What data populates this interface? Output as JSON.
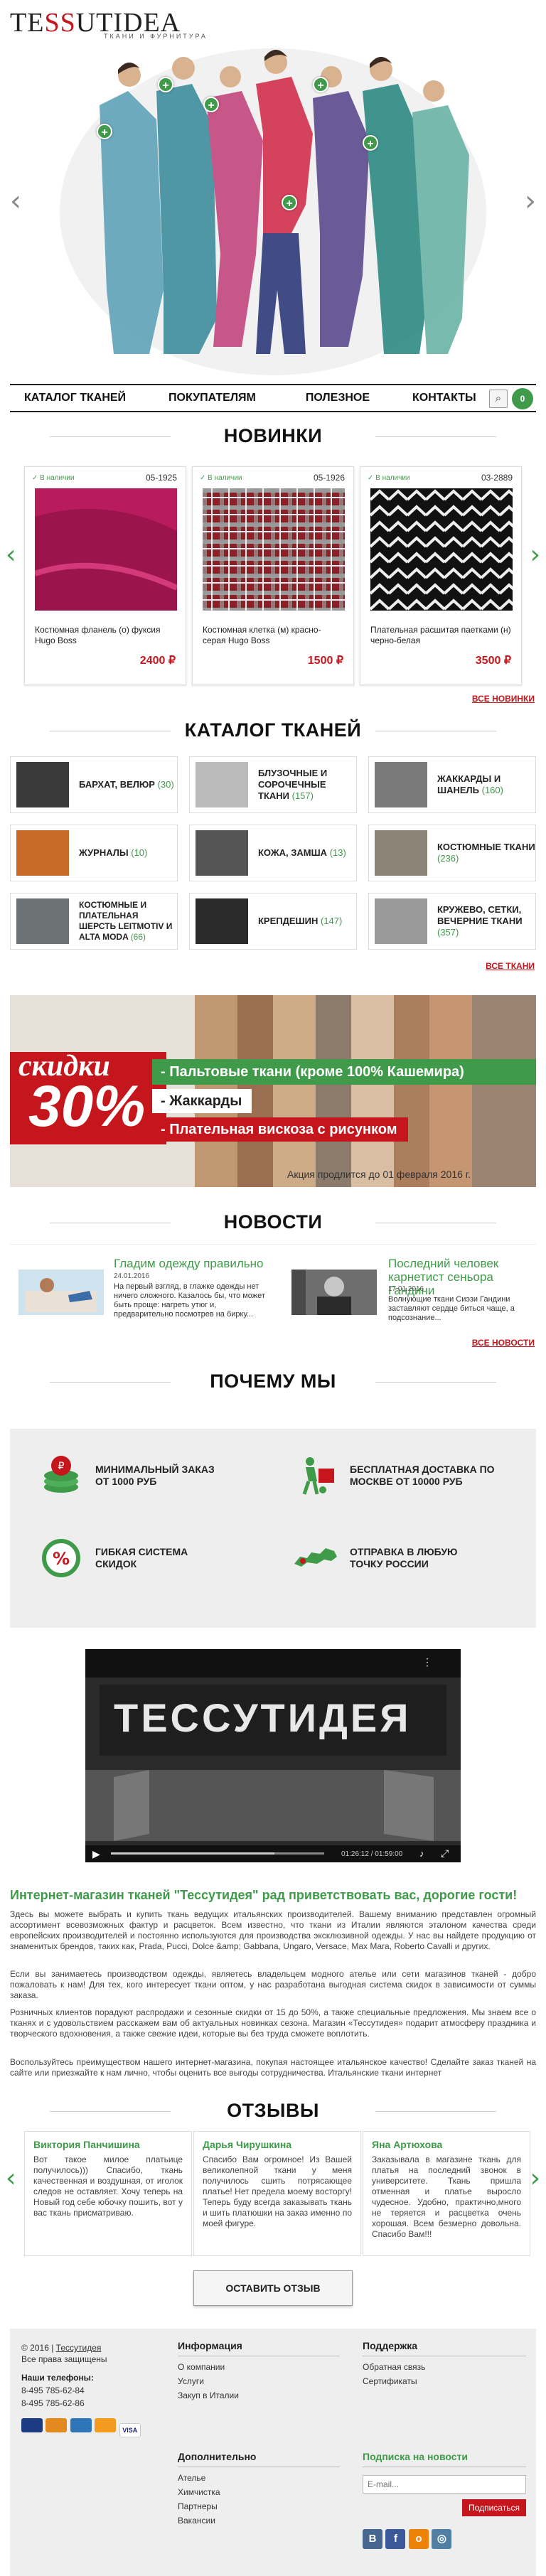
{
  "header": {
    "logo_main_left": "TE",
    "logo_main_accent": "SS",
    "logo_main_right": "UTIDEA",
    "logo_sub": "ТКАНИ И ФУРНИТУРА"
  },
  "nav": {
    "items": [
      "КАТАЛОГ ТКАНЕЙ",
      "ПОКУПАТЕЛЯМ",
      "ПОЛЕЗНОЕ",
      "КОНТАКТЫ"
    ],
    "search_icon": "search-icon",
    "cart_count": "0"
  },
  "new_arrivals": {
    "title": "НОВИНКИ",
    "more": "ВСЕ НОВИНКИ",
    "products": [
      {
        "stock": "В наличии",
        "code": "05-1925",
        "name": "Костюмная фланель (о) фуксия Hugo Boss",
        "price": "2400 ₽",
        "color": "#c02a6e"
      },
      {
        "stock": "В наличии",
        "code": "05-1926",
        "name": "Костюмная клетка (м) красно-серая Hugo Boss",
        "price": "1500 ₽",
        "color": "#9c2a2e"
      },
      {
        "stock": "В наличии",
        "code": "03-2889",
        "name": "Плательная расшитая паетками (н) черно-белая",
        "price": "3500 ₽",
        "color": "#222222"
      }
    ]
  },
  "catalog": {
    "title": "КАТАЛОГ ТКАНЕЙ",
    "more": "ВСЕ ТКАНИ",
    "items": [
      {
        "label": "БАРХАТ, ВЕЛЮР",
        "count": "(30)",
        "color": "#3a3a3a"
      },
      {
        "label": "БЛУЗОЧНЫЕ И СОРОЧЕЧНЫЕ ТКАНИ",
        "count": "(157)",
        "color": "#bbbbbb"
      },
      {
        "label": "ЖАККАРДЫ И ШАНЕЛЬ",
        "count": "(160)",
        "color": "#7a7a7a"
      },
      {
        "label": "ЖУРНАЛЫ",
        "count": "(10)",
        "color": "#c86a2a"
      },
      {
        "label": "КОЖА, ЗАМША",
        "count": "(13)",
        "color": "#555555"
      },
      {
        "label": "КОСТЮМНЫЕ ТКАНИ",
        "count": "(236)",
        "color": "#8d8478"
      },
      {
        "label": "КОСТЮМНЫЕ И ПЛАТЕЛЬНАЯ ШЕРСТЬ LEITMOTIV И ALTA MODA",
        "count": "(66)",
        "color": "#6d7274"
      },
      {
        "label": "КРЕПДЕШИН",
        "count": "(147)",
        "color": "#2a2a2a"
      },
      {
        "label": "КРУЖЕВО, СЕТКИ, ВЕЧЕРНИЕ ТКАНИ",
        "count": "(357)",
        "color": "#9a9a9a"
      }
    ]
  },
  "banner": {
    "discount_word": "скидки",
    "discount_value": "30%",
    "lines": [
      "- Пальтовые ткани (кроме 100% Кашемира)",
      "- Жаккарды",
      "- Плательная вискоза с рисунком"
    ],
    "footnote": "Акция продлится до 01 февраля 2016 г."
  },
  "news": {
    "title": "НОВОСТИ",
    "more": "ВСЕ НОВОСТИ",
    "items": [
      {
        "title": "Гладим одежду правильно",
        "date": "24.01.2016",
        "text": "На первый взгляд, в глажке одежды нет ничего сложного. Казалось бы, что может быть проще: нагреть утюг и, предварительно посмотрев на бирку..."
      },
      {
        "title": "Последний человек карнетист сеньора Гандини",
        "date": "17.01.2016",
        "text": "Волнующие ткани Сиэзи Гандини заставляют сердце биться чаще, а подсознание..."
      }
    ]
  },
  "why": {
    "title": "ПОЧЕМУ МЫ",
    "items": [
      {
        "text": "МИНИМАЛЬНЫЙ ЗАКАЗ ОТ 1000 РУБ",
        "icon": "coins-icon"
      },
      {
        "text": "БЕСПЛАТНАЯ ДОСТАВКА ПО МОСКВЕ ОТ 10000 РУБ",
        "icon": "delivery-icon"
      },
      {
        "text": "ГИБКАЯ СИСТЕМА СКИДОК",
        "icon": "discount-icon"
      },
      {
        "text": "ОТПРАВКА В ЛЮБУЮ ТОЧКУ РОССИИ",
        "icon": "russia-map-icon"
      }
    ]
  },
  "video": {
    "sign": "ТЕССУТИДЕЯ",
    "time": "01:26:12 / 01:59:00"
  },
  "about": {
    "title": "Интернет-магазин тканей \"Тессутидея\" рад приветствовать вас, дорогие гости!",
    "p1": "Здесь вы можете выбрать и купить ткань ведущих итальянских производителей. Вашему вниманию представлен огромный ассортимент всевозможных фактур и расцветок. Всем известно, что ткани из Италии являются эталоном качества среди европейских производителей и постоянно используются для производства эксклюзивной одежды. У нас вы найдете продукцию от знаменитых брендов, таких как, Prada, Pucci, Dolce &amp; Gabbana, Ungaro, Versace, Max Mara, Roberto Cavalli и других.",
    "p2": "Если вы занимаетесь производством одежды, являетесь владельцем модного ателье или сети магазинов тканей - добро пожаловать к нам! Для тех, кого интересует ткани оптом, у нас разработана выгодная система скидок в зависимости от суммы заказа.",
    "p3": "Розничных клиентов порадуют распродажи и сезонные скидки от 15 до 50%, а также специальные предложения. Мы знаем все о тканях и с удовольствием расскажем вам об актуальных новинках сезона. Магазин «Тессутидея» подарит атмосферу праздника и творческого вдохновения, а также свежие идеи, которые вы без труда сможете воплотить.",
    "p4": "Воспользуйтесь преимуществом нашего интернет-магазина, покупая настоящее итальянское качество! Сделайте заказ тканей на сайте или приезжайте к нам лично, чтобы оценить все выгоды сотрудничества. Итальянские ткани интернет"
  },
  "reviews": {
    "title": "ОТЗЫВЫ",
    "button": "ОСТАВИТЬ ОТЗЫВ",
    "items": [
      {
        "name": "Виктория Панчишина",
        "text": "Вот такое милое платьице получилось))) Спасибо, ткань качественная и воздушная, от иголок следов не оставляет. Хочу теперь на Новый год себе юбочку пошить, вот у вас ткань присматриваю."
      },
      {
        "name": "Дарья Чирушкина",
        "text": "Спасибо Вам огромное! Из Вашей великолепной ткани у меня получилось сшить потрясающее платье! Нет предела моему восторгу! Теперь буду всегда заказывать ткань и шить платюшки на заказ именно по моей фигуре."
      },
      {
        "name": "Яна Артюхова",
        "text": "Заказывала в магазине ткань для платья на последний звонок в университете. Ткань пришла отменная и платье выросло чудесное. Удобно, практично,много не теряется и расцветка очень хорошая. Всем безмерно довольна. Спасибо Вам!!!"
      }
    ]
  },
  "footer": {
    "copyright": "© 2016 |",
    "copyright_link": "Тессутидея",
    "rights": "Все права защищены",
    "phones_label": "Наши телефоны:",
    "phone1": "8-495 785-62-84",
    "phone2": "8-495 785-62-86",
    "info_title": "Информация",
    "info_links": [
      "О компании",
      "Услуги",
      "Закуп в Италии"
    ],
    "extra_title": "Дополнительно",
    "extra_links": [
      "Ателье",
      "Химчистка",
      "Партнеры",
      "Вакансии"
    ],
    "support_title": "Поддержка",
    "support_links": [
      "Обратная связь",
      "Сертификаты"
    ],
    "subscribe_title": "Подписка на новости",
    "email_placeholder": "E-mail...",
    "subscribe_button": "Подписаться",
    "payments": [
      "mastercard",
      "maestro",
      "webmoney",
      "qiwi",
      "visa"
    ],
    "socials": [
      "vk",
      "facebook",
      "odnoklassniki",
      "instagram"
    ]
  }
}
